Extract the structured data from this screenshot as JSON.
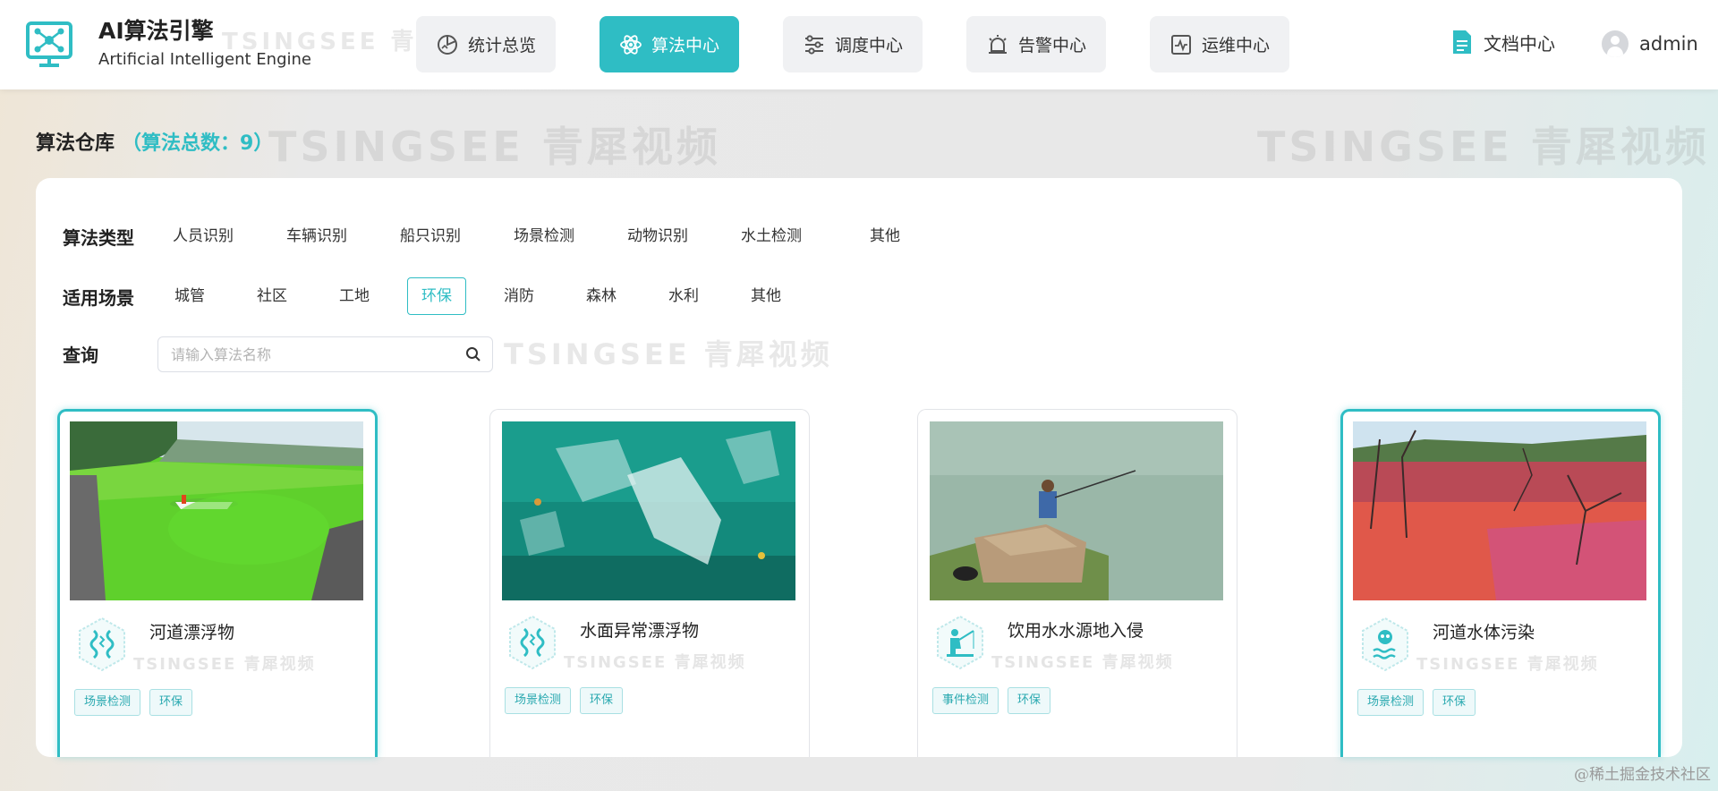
{
  "header": {
    "title": "AI算法引擎",
    "subtitle": "Artificial Intelligent Engine",
    "tabs": [
      {
        "label": "统计总览"
      },
      {
        "label": "算法中心"
      },
      {
        "label": "调度中心"
      },
      {
        "label": "告警中心"
      },
      {
        "label": "运维中心"
      }
    ],
    "active_tab": "算法中心",
    "doc_link": "文档中心",
    "user": "admin"
  },
  "watermark": "TSINGSEE 青犀视频",
  "page": {
    "title": "算法仓库",
    "count_text": "（算法总数：9）"
  },
  "filters": {
    "type_label": "算法类型",
    "types": [
      "人员识别",
      "车辆识别",
      "船只识别",
      "场景检测",
      "动物识别",
      "水土检测",
      "其他"
    ],
    "scene_label": "适用场景",
    "scenes": [
      "城管",
      "社区",
      "工地",
      "环保",
      "消防",
      "森林",
      "水利",
      "其他"
    ],
    "active_scene": "环保",
    "query_label": "查询",
    "search_placeholder": "请输入算法名称"
  },
  "cards": [
    {
      "title": "河道漂浮物",
      "tags": [
        "场景检测",
        "环保"
      ],
      "selected": true,
      "icon": "floating-debris-icon"
    },
    {
      "title": "水面异常漂浮物",
      "tags": [
        "场景检测",
        "环保"
      ],
      "selected": false,
      "icon": "floating-debris-icon"
    },
    {
      "title": "饮用水水源地入侵",
      "tags": [
        "事件检测",
        "环保"
      ],
      "selected": false,
      "icon": "fishing-icon"
    },
    {
      "title": "河道水体污染",
      "tags": [
        "场景检测",
        "环保"
      ],
      "selected": true,
      "icon": "pollution-icon"
    }
  ],
  "footer": "@稀土掘金技术社区",
  "colors": {
    "accent": "#2fbdc4",
    "tag_bg": "#eef9fa"
  }
}
